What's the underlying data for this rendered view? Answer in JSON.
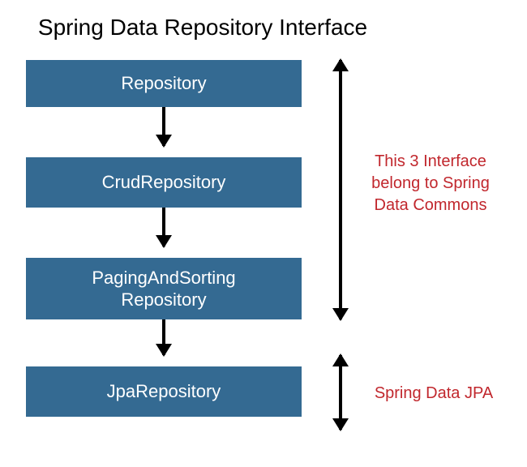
{
  "title": "Spring Data Repository Interface",
  "boxes": [
    {
      "label": "Repository"
    },
    {
      "label": "CrudRepository"
    },
    {
      "label_line1": "PagingAndSorting",
      "label_line2": "Repository"
    },
    {
      "label": "JpaRepository"
    }
  ],
  "annotations": {
    "commons": "This 3 Interface belong to Spring Data Commons",
    "jpa": "Spring Data JPA"
  },
  "colors": {
    "box_bg": "#346a92",
    "box_text": "#ffffff",
    "annotation_text": "#c1272d"
  }
}
